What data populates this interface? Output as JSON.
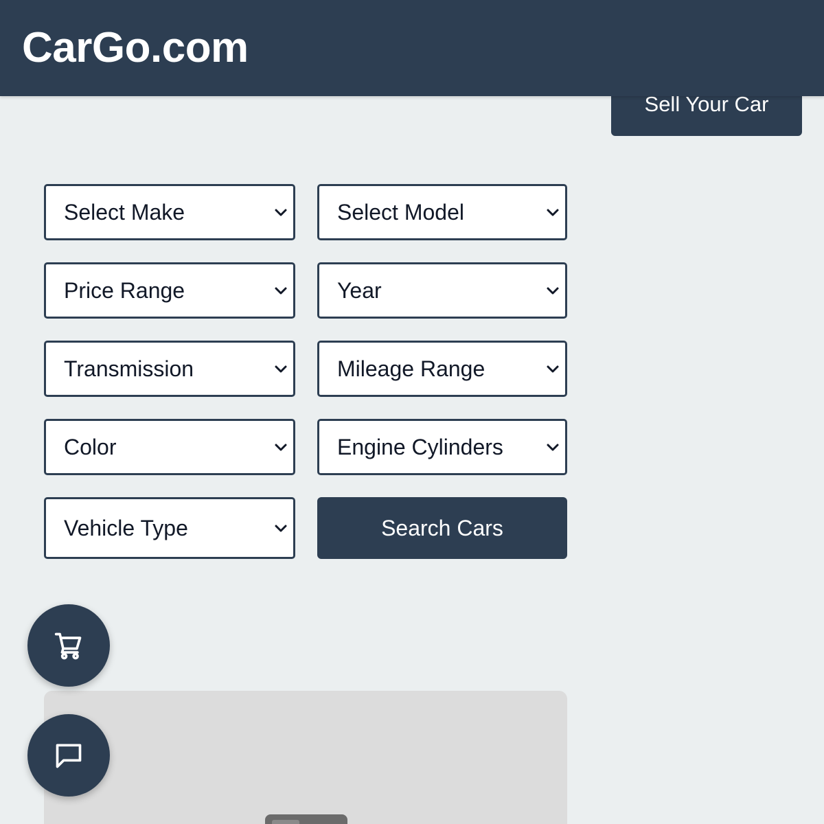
{
  "header": {
    "logo": "CarGo.com",
    "sell_button_label": "Sell Your Car"
  },
  "filters": {
    "make": "Select Make",
    "model": "Select Model",
    "price": "Price Range",
    "year": "Year",
    "transmission": "Transmission",
    "mileage": "Mileage Range",
    "color": "Color",
    "cylinders": "Engine Cylinders",
    "vehicle_type": "Vehicle Type"
  },
  "search_button_label": "Search Cars",
  "fabs": {
    "cart_icon": "shopping-cart-icon",
    "chat_icon": "chat-bubble-icon"
  },
  "colors": {
    "primary": "#2d3e52",
    "background": "#ebeff0",
    "card": "#dcdcdc"
  }
}
